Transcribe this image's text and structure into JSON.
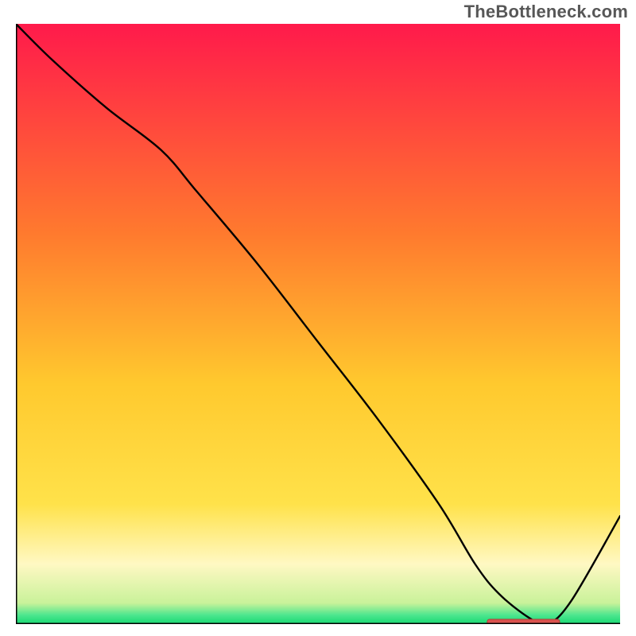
{
  "branding": {
    "watermark": "TheBottleneck.com"
  },
  "colors": {
    "top": "#ff1a4b",
    "orange": "#ff8a2a",
    "yellow_mid": "#ffd531",
    "pale_yellow": "#fff8c3",
    "green": "#1ee07b",
    "axis": "#000000",
    "curve": "#000000",
    "marker_fill": "#d9534f",
    "marker_stroke": "#b23e3a"
  },
  "chart_data": {
    "type": "line",
    "title": "",
    "xlabel": "",
    "ylabel": "",
    "xlim": [
      0,
      100
    ],
    "ylim": [
      0,
      100
    ],
    "series": [
      {
        "name": "bottleneck-curve",
        "x": [
          0,
          6,
          15,
          24,
          30,
          40,
          50,
          60,
          70,
          76,
          80,
          85,
          88,
          92,
          100
        ],
        "y": [
          100,
          94,
          86,
          79,
          72,
          60,
          47,
          34,
          20,
          10,
          5,
          1,
          0,
          4,
          18
        ]
      }
    ],
    "optimal_band": {
      "x_start": 78,
      "x_end": 90,
      "y": 0
    },
    "gradient_stops": [
      {
        "offset": 0.0,
        "color": "#ff1a4b"
      },
      {
        "offset": 0.35,
        "color": "#ff7a2e"
      },
      {
        "offset": 0.6,
        "color": "#ffc92e"
      },
      {
        "offset": 0.8,
        "color": "#ffe24a"
      },
      {
        "offset": 0.9,
        "color": "#fff8c3"
      },
      {
        "offset": 0.965,
        "color": "#c9f29a"
      },
      {
        "offset": 0.985,
        "color": "#4de68e"
      },
      {
        "offset": 1.0,
        "color": "#17d872"
      }
    ]
  }
}
